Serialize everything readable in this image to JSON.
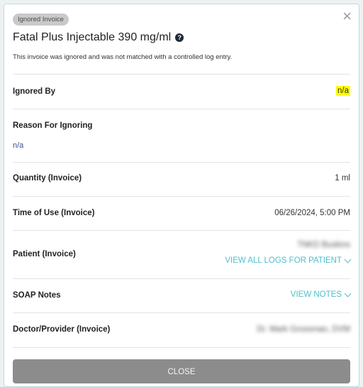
{
  "modal": {
    "badge": "Ignored Invoice",
    "title": "Fatal Plus Injectable 390 mg/ml",
    "help_glyph": "?",
    "close_glyph": "×",
    "subtitle": "This invoice was ignored and was not matched with a controlled log entry."
  },
  "details": {
    "ignored_by": {
      "label": "Ignored By",
      "value": "n/a"
    },
    "reason": {
      "label": "Reason For Ignoring",
      "value": "n/a"
    },
    "quantity": {
      "label": "Quantity (Invoice)",
      "value": "1 ml"
    },
    "time_of_use": {
      "label": "Time of Use (Invoice)",
      "value": "06/26/2024, 5:00 PM"
    },
    "patient": {
      "label": "Patient (Invoice)",
      "value": "TNKD Buskins",
      "link": "VIEW ALL LOGS FOR PATIENT"
    },
    "soap": {
      "label": "SOAP Notes",
      "link": "VIEW NOTES"
    },
    "doctor": {
      "label": "Doctor/Provider (Invoice)",
      "value": "Dr. Mark Grossman, DVM"
    }
  },
  "footer": {
    "close_label": "CLOSE"
  },
  "colors": {
    "accent": "#4cbfce",
    "highlight": "#ffff00",
    "button": "#8c8c8c"
  }
}
